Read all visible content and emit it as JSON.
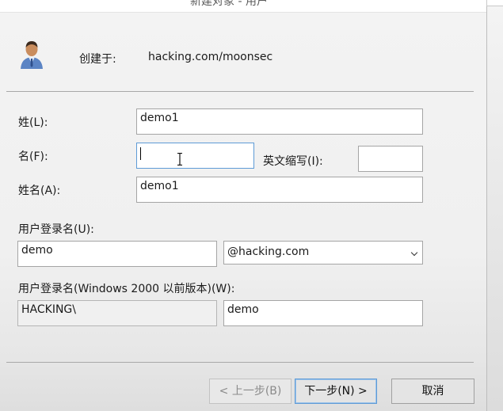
{
  "window": {
    "title_fragment": "新建对象 - 用户"
  },
  "header": {
    "created_in_label": "创建于:",
    "created_in_value": "hacking.com/moonsec"
  },
  "form": {
    "last_name": {
      "label": "姓(L):",
      "value": "demo1"
    },
    "first_name": {
      "label": "名(F):",
      "value": ""
    },
    "initials": {
      "label": "英文缩写(I):",
      "value": ""
    },
    "full_name": {
      "label": "姓名(A):",
      "value": "demo1"
    },
    "logon_name": {
      "label": "用户登录名(U):",
      "value": "demo",
      "domain_selected": "@hacking.com"
    },
    "pre2000_logon": {
      "label": "用户登录名(Windows 2000 以前版本)(W):",
      "domain_prefix": "HACKING\\",
      "value": "demo"
    }
  },
  "buttons": {
    "back": "< 上一步(B)",
    "next": "下一步(N) >",
    "cancel": "取消"
  }
}
